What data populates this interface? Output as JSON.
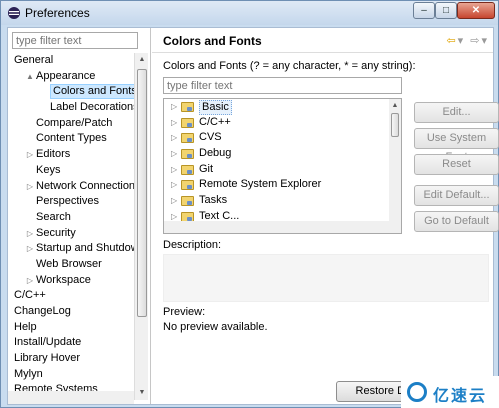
{
  "window": {
    "title": "Preferences"
  },
  "left": {
    "filter_placeholder": "type filter text",
    "tree": [
      {
        "label": "General",
        "level": 0,
        "twisty": ""
      },
      {
        "label": "Appearance",
        "level": 1,
        "twisty": "▲"
      },
      {
        "label": "Colors and Fonts",
        "level": 2,
        "twisty": "",
        "selected": true
      },
      {
        "label": "Label Decorations",
        "level": 2,
        "twisty": ""
      },
      {
        "label": "Compare/Patch",
        "level": 1,
        "twisty": ""
      },
      {
        "label": "Content Types",
        "level": 1,
        "twisty": ""
      },
      {
        "label": "Editors",
        "level": 1,
        "twisty": "▷"
      },
      {
        "label": "Keys",
        "level": 1,
        "twisty": ""
      },
      {
        "label": "Network Connections",
        "level": 1,
        "twisty": "▷"
      },
      {
        "label": "Perspectives",
        "level": 1,
        "twisty": ""
      },
      {
        "label": "Search",
        "level": 1,
        "twisty": ""
      },
      {
        "label": "Security",
        "level": 1,
        "twisty": "▷"
      },
      {
        "label": "Startup and Shutdown",
        "level": 1,
        "twisty": "▷"
      },
      {
        "label": "Web Browser",
        "level": 1,
        "twisty": ""
      },
      {
        "label": "Workspace",
        "level": 1,
        "twisty": "▷"
      },
      {
        "label": "C/C++",
        "level": 0,
        "twisty": ""
      },
      {
        "label": "ChangeLog",
        "level": 0,
        "twisty": ""
      },
      {
        "label": "Help",
        "level": 0,
        "twisty": ""
      },
      {
        "label": "Install/Update",
        "level": 0,
        "twisty": ""
      },
      {
        "label": "Library Hover",
        "level": 0,
        "twisty": ""
      },
      {
        "label": "Mylyn",
        "level": 0,
        "twisty": ""
      },
      {
        "label": "Remote Systems",
        "level": 0,
        "twisty": ""
      }
    ]
  },
  "right": {
    "title": "Colors and Fonts",
    "intro": "Colors and Fonts (? = any character, * = any string):",
    "filter_placeholder": "type filter text",
    "list": [
      {
        "label": "Basic",
        "selected": true
      },
      {
        "label": "C/C++"
      },
      {
        "label": "CVS"
      },
      {
        "label": "Debug"
      },
      {
        "label": "Git"
      },
      {
        "label": "Remote System Explorer"
      },
      {
        "label": "Tasks"
      },
      {
        "label": "Text C..."
      }
    ],
    "buttons": {
      "edit": "Edit...",
      "use_system_font": "Use System Font",
      "reset": "Reset",
      "edit_default": "Edit Default...",
      "go_to_default": "Go to Default"
    },
    "description_label": "Description:",
    "preview_label": "Preview:",
    "preview_text": "No preview available.",
    "restore_defaults": "Restore Defau"
  },
  "watermark": {
    "text": "亿速云"
  }
}
